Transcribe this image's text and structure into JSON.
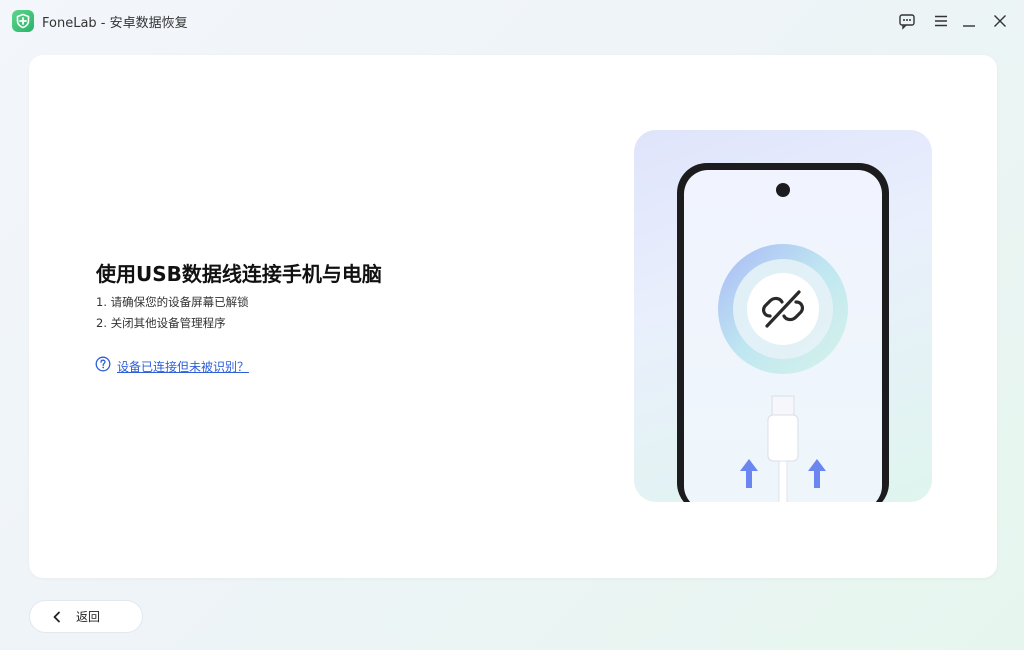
{
  "window": {
    "title": "FoneLab - 安卓数据恢复",
    "controls": [
      "feedback-icon",
      "menu-icon",
      "minimize-icon",
      "close-icon"
    ]
  },
  "main": {
    "heading": "使用USB数据线连接手机与电脑",
    "steps": [
      "1. 请确保您的设备屏幕已解锁",
      "2. 关闭其他设备管理程序"
    ],
    "help_link": "设备已连接但未被识别？"
  },
  "footer": {
    "back_label": "返回"
  },
  "colors": {
    "accent_green": "#2fbf71",
    "link_blue": "#2f5fd8",
    "arrow_blue": "#6b86f0"
  }
}
